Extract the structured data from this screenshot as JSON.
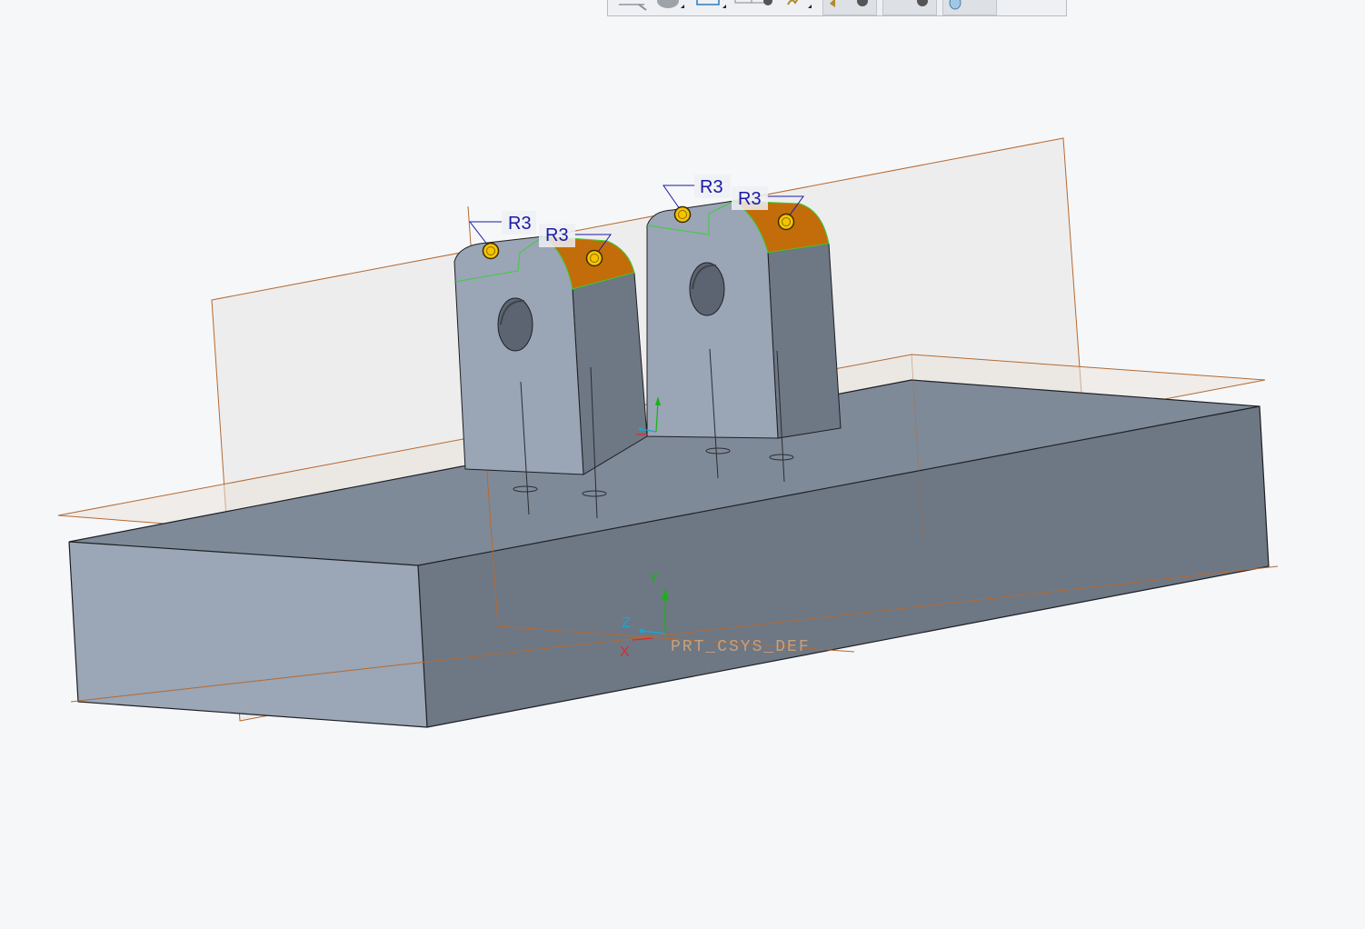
{
  "toolbar": {
    "buttons": [
      {
        "icon": "zoom-icon"
      },
      {
        "icon": "shading-sphere-icon"
      },
      {
        "icon": "view-box-icon"
      },
      {
        "icon": "saved-views-icon"
      },
      {
        "icon": "annotation-display-icon"
      },
      {
        "icon": "datum-display-icon"
      },
      {
        "icon": "spin-center-icon"
      },
      {
        "icon": "appearance-icon"
      }
    ]
  },
  "dimensions": {
    "d1": "R3",
    "d2": "R3",
    "d3": "R3",
    "d4": "R3"
  },
  "csys": {
    "name": "PRT_CSYS_DEF",
    "axis_y": "Y",
    "axis_z": "Z",
    "axis_x": "X"
  },
  "colors": {
    "background": "#f6f7f9",
    "part_front": "#9aa5b5",
    "part_side": "#6e7784",
    "part_top": "#7f8a98",
    "highlight_round": "#c36d0a",
    "datum_edge": "#b46a32",
    "dimension_text": "#1a1aa6",
    "handle_fill": "#f5c400"
  }
}
